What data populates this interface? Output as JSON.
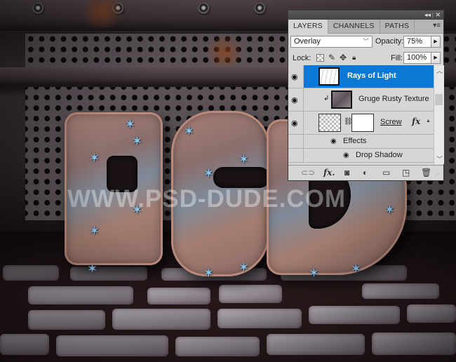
{
  "artwork": {
    "watermark": "WWW.PSD-DUDE.COM",
    "letters": [
      "P",
      "S",
      "D"
    ],
    "colors": {
      "rust": "#a98277",
      "steel_blue": "#7f8a99",
      "star_blue": "#8fc6e8",
      "stone": "#c9c1c9"
    }
  },
  "panel": {
    "title_controls": {
      "collapse": "◂◂",
      "close": "✕"
    },
    "tabs": [
      {
        "label": "LAYERS",
        "active": true
      },
      {
        "label": "CHANNELS",
        "active": false
      },
      {
        "label": "PATHS",
        "active": false
      }
    ],
    "tab_menu_icon": "panel-menu-icon",
    "blend_mode": "Overlay",
    "opacity_label": "Opacity:",
    "opacity_value": "75%",
    "lock_label": "Lock:",
    "fill_label": "Fill:",
    "fill_value": "100%",
    "layers": [
      {
        "name": "Rays of Light",
        "selected": true,
        "visible": true,
        "clipped": false
      },
      {
        "name": "Gruge Rusty Texture",
        "selected": false,
        "visible": true,
        "clipped": true
      },
      {
        "name": "Screw",
        "selected": false,
        "visible": true,
        "clipped": false,
        "has_mask": true,
        "has_fx": true,
        "fx_label": "fx"
      }
    ],
    "effects": {
      "label": "Effects",
      "items": [
        "Drop Shadow"
      ]
    },
    "bottom_icons": [
      "link-layers-icon",
      "fx-icon",
      "add-mask-icon",
      "adjustment-layer-icon",
      "new-group-icon",
      "new-layer-icon",
      "delete-layer-icon"
    ],
    "accent_color": "#0b78d6"
  }
}
